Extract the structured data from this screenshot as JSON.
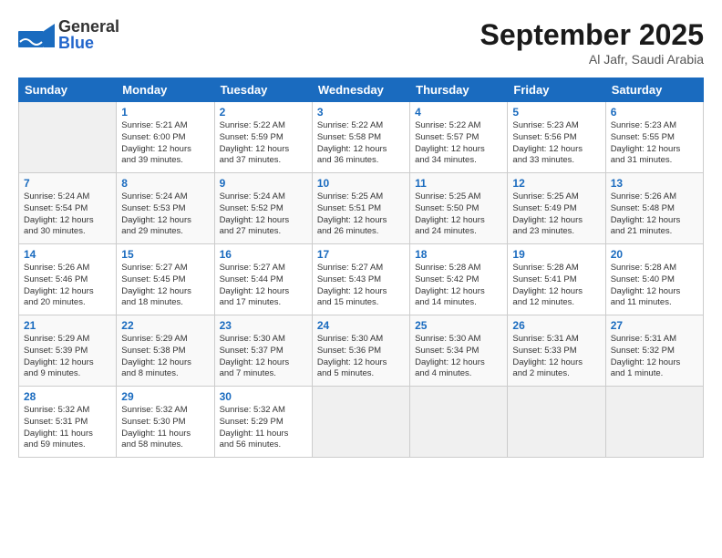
{
  "header": {
    "logo_general": "General",
    "logo_blue": "Blue",
    "month": "September 2025",
    "location": "Al Jafr, Saudi Arabia"
  },
  "days_of_week": [
    "Sunday",
    "Monday",
    "Tuesday",
    "Wednesday",
    "Thursday",
    "Friday",
    "Saturday"
  ],
  "weeks": [
    [
      {
        "day": "",
        "info": ""
      },
      {
        "day": "1",
        "info": "Sunrise: 5:21 AM\nSunset: 6:00 PM\nDaylight: 12 hours\nand 39 minutes."
      },
      {
        "day": "2",
        "info": "Sunrise: 5:22 AM\nSunset: 5:59 PM\nDaylight: 12 hours\nand 37 minutes."
      },
      {
        "day": "3",
        "info": "Sunrise: 5:22 AM\nSunset: 5:58 PM\nDaylight: 12 hours\nand 36 minutes."
      },
      {
        "day": "4",
        "info": "Sunrise: 5:22 AM\nSunset: 5:57 PM\nDaylight: 12 hours\nand 34 minutes."
      },
      {
        "day": "5",
        "info": "Sunrise: 5:23 AM\nSunset: 5:56 PM\nDaylight: 12 hours\nand 33 minutes."
      },
      {
        "day": "6",
        "info": "Sunrise: 5:23 AM\nSunset: 5:55 PM\nDaylight: 12 hours\nand 31 minutes."
      }
    ],
    [
      {
        "day": "7",
        "info": "Sunrise: 5:24 AM\nSunset: 5:54 PM\nDaylight: 12 hours\nand 30 minutes."
      },
      {
        "day": "8",
        "info": "Sunrise: 5:24 AM\nSunset: 5:53 PM\nDaylight: 12 hours\nand 29 minutes."
      },
      {
        "day": "9",
        "info": "Sunrise: 5:24 AM\nSunset: 5:52 PM\nDaylight: 12 hours\nand 27 minutes."
      },
      {
        "day": "10",
        "info": "Sunrise: 5:25 AM\nSunset: 5:51 PM\nDaylight: 12 hours\nand 26 minutes."
      },
      {
        "day": "11",
        "info": "Sunrise: 5:25 AM\nSunset: 5:50 PM\nDaylight: 12 hours\nand 24 minutes."
      },
      {
        "day": "12",
        "info": "Sunrise: 5:25 AM\nSunset: 5:49 PM\nDaylight: 12 hours\nand 23 minutes."
      },
      {
        "day": "13",
        "info": "Sunrise: 5:26 AM\nSunset: 5:48 PM\nDaylight: 12 hours\nand 21 minutes."
      }
    ],
    [
      {
        "day": "14",
        "info": "Sunrise: 5:26 AM\nSunset: 5:46 PM\nDaylight: 12 hours\nand 20 minutes."
      },
      {
        "day": "15",
        "info": "Sunrise: 5:27 AM\nSunset: 5:45 PM\nDaylight: 12 hours\nand 18 minutes."
      },
      {
        "day": "16",
        "info": "Sunrise: 5:27 AM\nSunset: 5:44 PM\nDaylight: 12 hours\nand 17 minutes."
      },
      {
        "day": "17",
        "info": "Sunrise: 5:27 AM\nSunset: 5:43 PM\nDaylight: 12 hours\nand 15 minutes."
      },
      {
        "day": "18",
        "info": "Sunrise: 5:28 AM\nSunset: 5:42 PM\nDaylight: 12 hours\nand 14 minutes."
      },
      {
        "day": "19",
        "info": "Sunrise: 5:28 AM\nSunset: 5:41 PM\nDaylight: 12 hours\nand 12 minutes."
      },
      {
        "day": "20",
        "info": "Sunrise: 5:28 AM\nSunset: 5:40 PM\nDaylight: 12 hours\nand 11 minutes."
      }
    ],
    [
      {
        "day": "21",
        "info": "Sunrise: 5:29 AM\nSunset: 5:39 PM\nDaylight: 12 hours\nand 9 minutes."
      },
      {
        "day": "22",
        "info": "Sunrise: 5:29 AM\nSunset: 5:38 PM\nDaylight: 12 hours\nand 8 minutes."
      },
      {
        "day": "23",
        "info": "Sunrise: 5:30 AM\nSunset: 5:37 PM\nDaylight: 12 hours\nand 7 minutes."
      },
      {
        "day": "24",
        "info": "Sunrise: 5:30 AM\nSunset: 5:36 PM\nDaylight: 12 hours\nand 5 minutes."
      },
      {
        "day": "25",
        "info": "Sunrise: 5:30 AM\nSunset: 5:34 PM\nDaylight: 12 hours\nand 4 minutes."
      },
      {
        "day": "26",
        "info": "Sunrise: 5:31 AM\nSunset: 5:33 PM\nDaylight: 12 hours\nand 2 minutes."
      },
      {
        "day": "27",
        "info": "Sunrise: 5:31 AM\nSunset: 5:32 PM\nDaylight: 12 hours\nand 1 minute."
      }
    ],
    [
      {
        "day": "28",
        "info": "Sunrise: 5:32 AM\nSunset: 5:31 PM\nDaylight: 11 hours\nand 59 minutes."
      },
      {
        "day": "29",
        "info": "Sunrise: 5:32 AM\nSunset: 5:30 PM\nDaylight: 11 hours\nand 58 minutes."
      },
      {
        "day": "30",
        "info": "Sunrise: 5:32 AM\nSunset: 5:29 PM\nDaylight: 11 hours\nand 56 minutes."
      },
      {
        "day": "",
        "info": ""
      },
      {
        "day": "",
        "info": ""
      },
      {
        "day": "",
        "info": ""
      },
      {
        "day": "",
        "info": ""
      }
    ]
  ]
}
